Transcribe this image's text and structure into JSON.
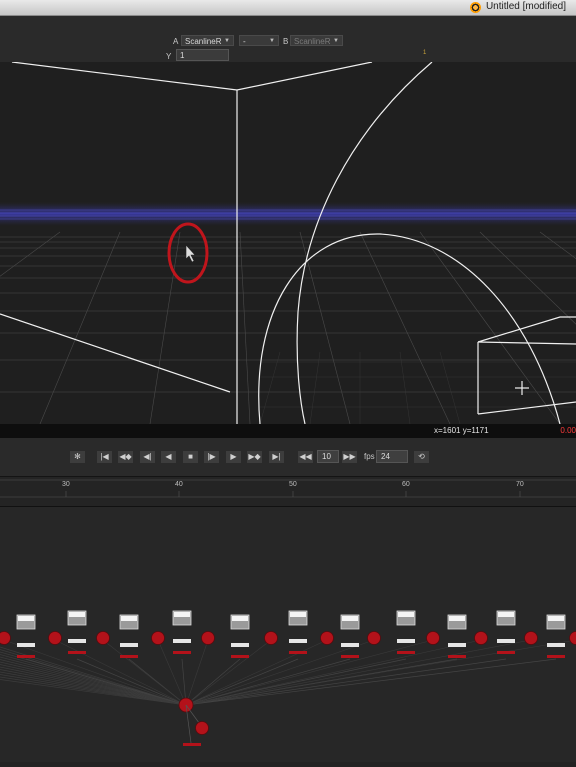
{
  "window": {
    "title": "Untitled [modified]"
  },
  "viewer": {
    "input_a_label": "A",
    "input_a_value": "ScanlineR",
    "operation_value": "-",
    "input_b_label": "B",
    "input_b_value": "ScanlineR",
    "y_label": "Y",
    "y_value": "1",
    "frame_marker": "1"
  },
  "status": {
    "coords": "x=1601 y=1171",
    "pixel_value": "0.00"
  },
  "transport": {
    "buttons": [
      "reset-icon",
      "first-frame-icon",
      "prev-keyframe-icon",
      "step-back-icon",
      "play-backward-icon",
      "stop-icon",
      "play-forward-icon",
      "step-forward-icon",
      "next-keyframe-icon",
      "last-frame-icon",
      "skip-back-icon",
      "skip-forward-icon",
      "loop-icon"
    ],
    "increment_value": "10",
    "fps_label": "fps",
    "fps_value": "24"
  },
  "timeline": {
    "tick_labels": [
      "30",
      "40",
      "50",
      "60",
      "70"
    ]
  },
  "colors": {
    "accent_red": "#ff3b3b",
    "horizon_blue": "#3a3aa8",
    "node_red": "#b3121a"
  }
}
